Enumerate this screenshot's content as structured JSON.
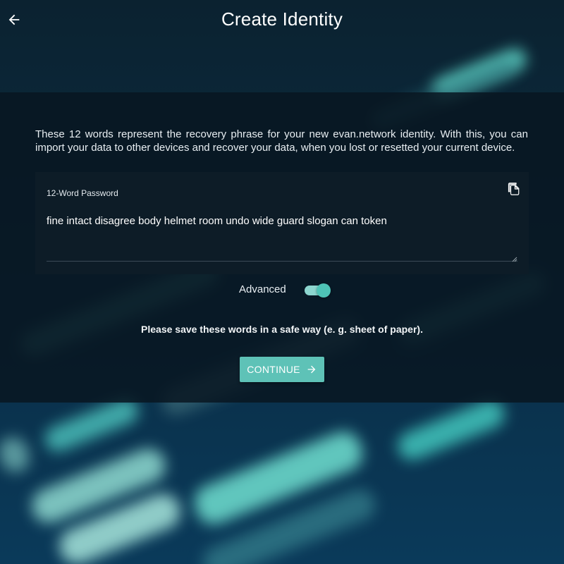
{
  "header": {
    "title": "Create Identity",
    "back_icon": "arrow-left-icon"
  },
  "intro": {
    "text": "These 12 words represent the recovery phrase for your new evan.network identity. With this, you can import your data to other devices and recover your data, when you lost or resetted your current device."
  },
  "password_field": {
    "label": "12-Word Password",
    "value": "fine intact disagree body helmet room undo wide guard slogan can token",
    "copy_icon": "copy-icon"
  },
  "advanced": {
    "label": "Advanced",
    "enabled": true
  },
  "save_note": "Please save these words in a safe way (e. g. sheet of paper).",
  "continue_button": {
    "label": "CONTINUE",
    "icon": "arrow-right-icon"
  },
  "colors": {
    "accent": "#5ec2b7",
    "panel": "#0d1c27"
  }
}
